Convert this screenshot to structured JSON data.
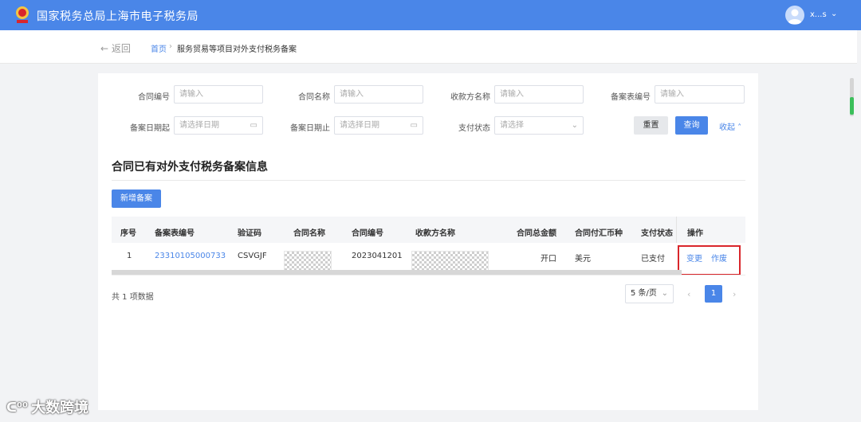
{
  "header": {
    "title": "国家税务总局上海市电子税务局",
    "user_name": "x...s",
    "logo_icon": "tax-emblem-icon"
  },
  "breadcrumb": {
    "back_label": "← 返回",
    "home": "首页",
    "separator": "›",
    "current": "服务贸易等项目对外支付税务备案"
  },
  "filters": {
    "contract_no": {
      "label": "合同编号",
      "placeholder": "请输入"
    },
    "contract_name": {
      "label": "合同名称",
      "placeholder": "请输入"
    },
    "payee_name": {
      "label": "收款方名称",
      "placeholder": "请输入"
    },
    "record_no": {
      "label": "备案表编号",
      "placeholder": "请输入"
    },
    "date_from": {
      "label": "备案日期起",
      "placeholder": "请选择日期"
    },
    "date_to": {
      "label": "备案日期止",
      "placeholder": "请选择日期"
    },
    "pay_status": {
      "label": "支付状态",
      "placeholder": "请选择"
    },
    "reset_label": "重置",
    "query_label": "查询",
    "collapse_label": "收起 ˄"
  },
  "section": {
    "title": "合同已有对外支付税务备案信息",
    "add_label": "新增备案"
  },
  "table": {
    "headers": {
      "seq": "序号",
      "record_no": "备案表编号",
      "verify_code": "验证码",
      "contract_name": "合同名称",
      "contract_no": "合同编号",
      "payee_name": "收款方名称",
      "total_amount": "合同总金额",
      "currency": "合同付汇币种",
      "pay_status": "支付状态",
      "actions": "操作"
    },
    "rows": [
      {
        "seq": "1",
        "record_no": "23310105000733",
        "verify_code": "CSVGJF",
        "contract_no": "2023041201",
        "total_amount": "开口",
        "currency": "美元",
        "pay_status": "已支付",
        "action_change": "变更",
        "action_void": "作废"
      }
    ]
  },
  "pagination": {
    "total_text": "共 1 项数据",
    "page_size": "5 条/页",
    "current_page": "1",
    "prev": "‹",
    "next": "›"
  },
  "watermark": {
    "text": "大数跨境"
  },
  "colors": {
    "primary": "#4a86e8",
    "highlight_border": "#d9262b"
  }
}
